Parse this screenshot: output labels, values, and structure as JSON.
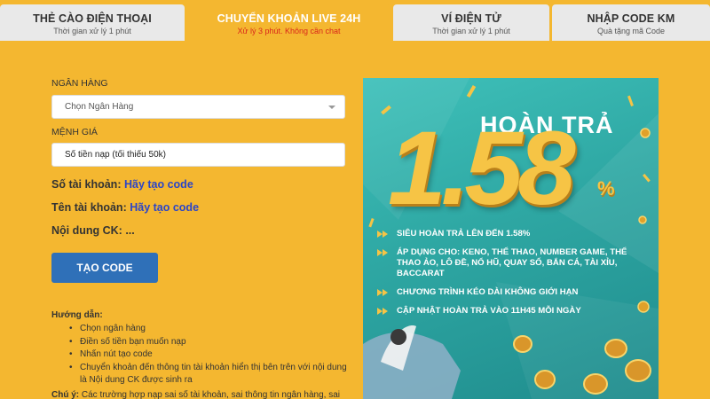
{
  "tabs": [
    {
      "title": "THẺ CÀO ĐIỆN THOẠI",
      "subtitle": "Thời gian xử lý 1 phút"
    },
    {
      "title": "CHUYỂN KHOẢN LIVE 24H",
      "subtitle": "Xử lý 3 phút. Không cần chat"
    },
    {
      "title": "VÍ ĐIỆN TỬ",
      "subtitle": "Thời gian xử lý 1 phút"
    },
    {
      "title": "NHẬP CODE KM",
      "subtitle": "Quà tặng mã Code"
    }
  ],
  "active_tab": 1,
  "form": {
    "bank_label": "NGÂN HÀNG",
    "bank_select_value": "Chọn Ngân Hàng",
    "amount_label": "MỆNH GIÁ",
    "amount_placeholder": "Số tiền nạp (tối thiểu 50k)",
    "account_number_label": "Số tài khoản:",
    "account_number_link": "Hãy tạo code",
    "account_name_label": "Tên tài khoản:",
    "account_name_link": "Hãy tạo code",
    "transfer_content_label": "Nội dung CK:",
    "transfer_content_value": "...",
    "create_button": "TẠO CODE"
  },
  "guide": {
    "title": "Hướng dẫn:",
    "steps": [
      "Chọn ngân hàng",
      "Điền số tiền bạn muốn nạp",
      "Nhấn nút tạo code",
      "Chuyển khoản đến thông tin tài khoản hiển thị bên trên với nội dung là Nội dung CK được sinh ra"
    ],
    "note_label": "Chú ý:",
    "note_text": "Các trường hợp nạp sai số tài khoản, sai thông tin ngân hàng, sai"
  },
  "banner": {
    "title": "HOÀN TRẢ",
    "big_number": "1.58",
    "percent": "%",
    "bullets": [
      "SIÊU HOÀN TRẢ LÊN ĐẾN 1.58%",
      "ÁP DỤNG CHO: KENO, THỂ THAO, NUMBER GAME, THỂ THAO ẢO, LÔ ĐỀ, NỔ HŨ, QUAY SỐ, BẮN CÁ, TÀI XỈU, BACCARAT",
      "CHƯƠNG TRÌNH KÉO DÀI KHÔNG GIỚI HẠN",
      "CẬP NHẬT HOÀN TRẢ VÀO 11H45 MỖI NGÀY"
    ]
  },
  "colors": {
    "background": "#f4b730",
    "tab_inactive": "#e9e9e9",
    "button": "#2f70b8",
    "link": "#2b45c8",
    "subtitle_active": "#d9261c",
    "banner_teal": "#2ea7a3",
    "gold": "#f6c445"
  }
}
